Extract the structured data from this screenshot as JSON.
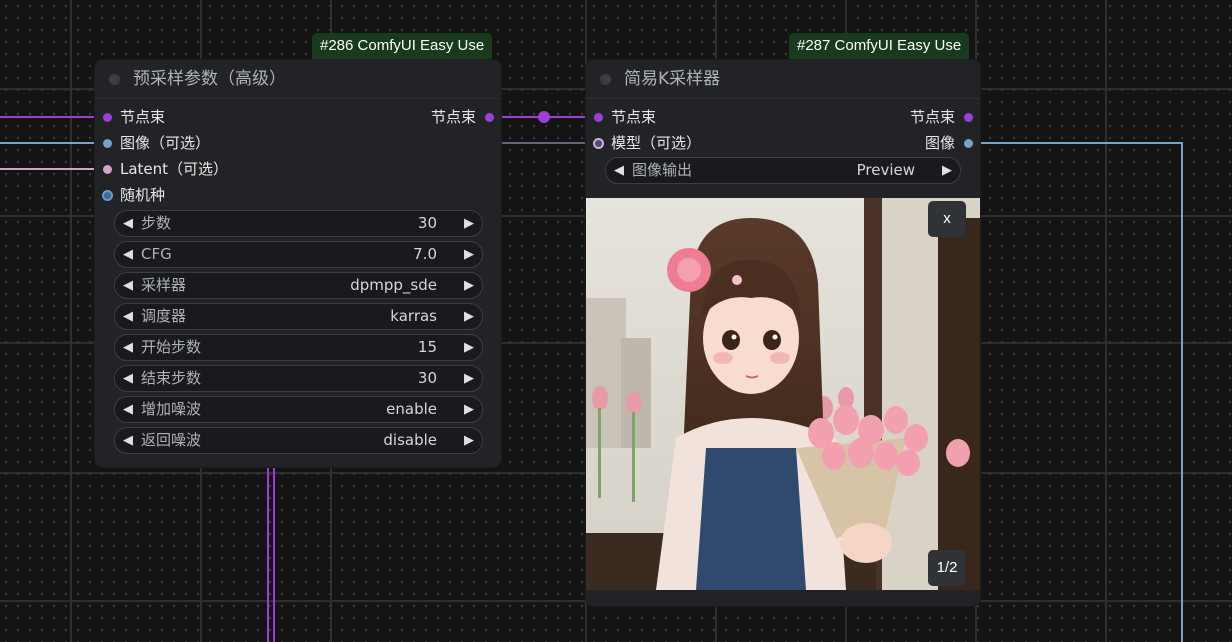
{
  "node286": {
    "badge": "#286 ComfyUI Easy Use",
    "title": "预采样参数（高级）",
    "inputs": [
      {
        "label": "节点束",
        "color": "#9c3fd6"
      },
      {
        "label": "图像（可选）",
        "color": "#7aa2c8"
      },
      {
        "label": "Latent（可选）",
        "color": "#d6a0c4"
      },
      {
        "label": "随机种",
        "color": "#3d6aa0"
      }
    ],
    "output": {
      "label": "节点束",
      "color": "#9c3fd6"
    },
    "widgets": [
      {
        "label": "步数",
        "value": "30"
      },
      {
        "label": "CFG",
        "value": "7.0"
      },
      {
        "label": "采样器",
        "value": "dpmpp_sde"
      },
      {
        "label": "调度器",
        "value": "karras"
      },
      {
        "label": "开始步数",
        "value": "15"
      },
      {
        "label": "结束步数",
        "value": "30"
      },
      {
        "label": "增加噪波",
        "value": "enable"
      },
      {
        "label": "返回噪波",
        "value": "disable"
      }
    ]
  },
  "node287": {
    "badge": "#287 ComfyUI Easy Use",
    "title": "简易K采样器",
    "inputs": [
      {
        "label": "节点束",
        "color": "#9c3fd6"
      },
      {
        "label": "模型（可选）",
        "color": "#c9b0e0"
      }
    ],
    "outputs": [
      {
        "label": "节点束",
        "color": "#9c3fd6"
      },
      {
        "label": "图像",
        "color": "#7aa2c8"
      }
    ],
    "widget": {
      "label": "图像输出",
      "value": "Preview"
    },
    "preview": {
      "close": "x",
      "counter": "1/2"
    }
  }
}
